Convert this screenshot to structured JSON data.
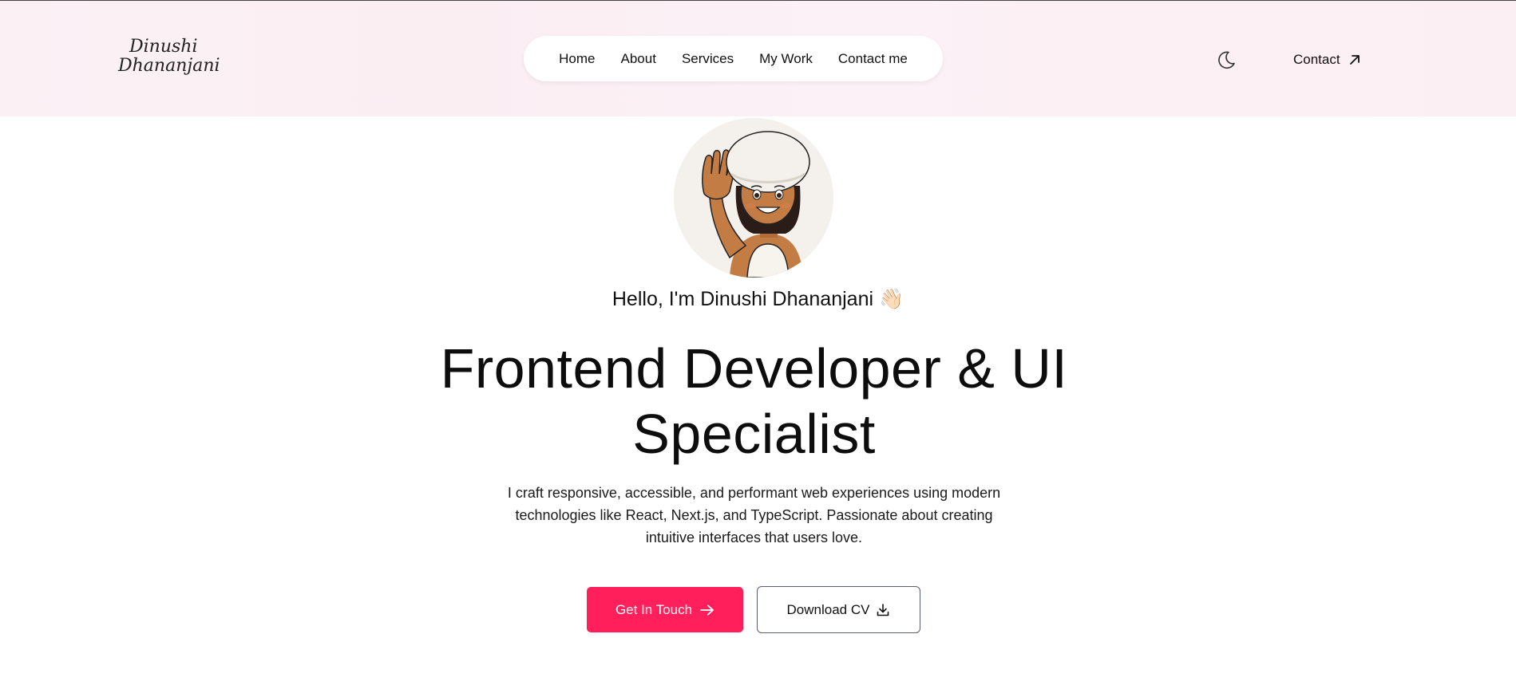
{
  "brand": {
    "line1": "Dinushi",
    "line2": "Dhananjani"
  },
  "nav": {
    "items": [
      {
        "label": "Home"
      },
      {
        "label": "About"
      },
      {
        "label": "Services"
      },
      {
        "label": "My Work"
      },
      {
        "label": "Contact me"
      }
    ]
  },
  "header_actions": {
    "theme_icon": "moon-icon",
    "contact_label": "Contact",
    "contact_icon": "arrow-up-right-icon"
  },
  "hero": {
    "avatar_icon": "waving-avatar-illustration",
    "greeting": "Hello, I'm Dinushi Dhananjani 👋🏻",
    "headline_line1": "Frontend Developer & UI",
    "headline_line2": "Specialist",
    "intro": "I craft responsive, accessible, and performant web experiences using modern technologies like React, Next.js, and TypeScript. Passionate about creating intuitive interfaces that users love.",
    "primary_cta": "Get In Touch",
    "primary_cta_icon": "arrow-right-icon",
    "secondary_cta": "Download CV",
    "secondary_cta_icon": "download-icon"
  },
  "colors": {
    "accent": "#fe1f5b",
    "header_bg": "#fbf0f4",
    "text": "#111111",
    "outline": "#5a5d6a"
  }
}
